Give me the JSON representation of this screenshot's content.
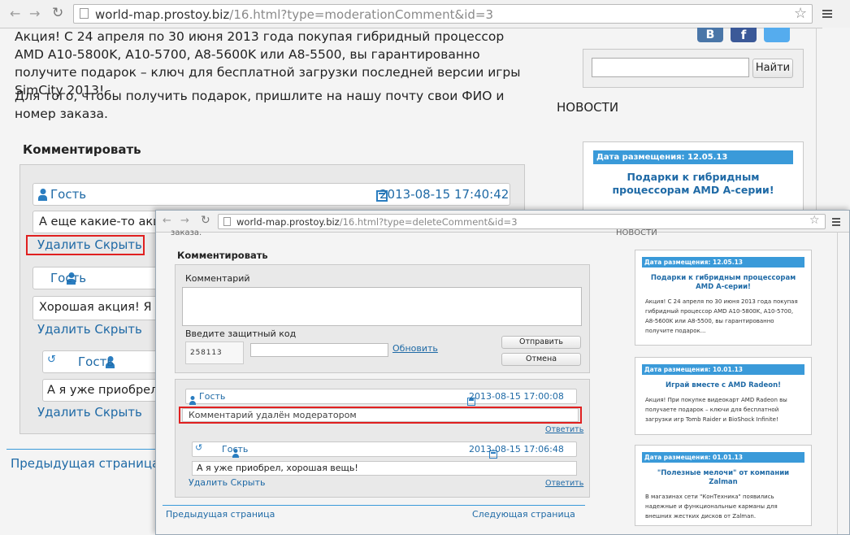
{
  "back_window": {
    "url_host": "world-map.prostoy.biz",
    "url_path": "/16.html?type=moderationComment&id=3",
    "article_p1": "Акция! С 24 апреля по 30 июня 2013 года покупая гибридный процессор AMD A10-5800K, A10-5700, A8-5600K или A8-5500, вы гарантированно получите подарок – ключ для бесплатной загрузки последней версии игры SimCity 2013!",
    "article_p2": "Для того, чтобы получить подарок, пришлите на нашу почту свои ФИО и номер заказа.",
    "comment_heading": "Комментировать",
    "comments": [
      {
        "author": "Гость",
        "date": "2013-08-15 17:40:42",
        "text": "А еще какие-то акц",
        "actions": "Удалить Скрыть"
      },
      {
        "author": "Гость",
        "text": "Хорошая акция! Я о",
        "actions": "Удалить Скрыть"
      },
      {
        "author": "Гость",
        "text": "А я уже приобрел",
        "actions": "Удалить Скрыть"
      }
    ],
    "prev_page": "Предыдущая страница",
    "social_icons": [
      "vk-icon",
      "facebook-icon",
      "twitter-icon"
    ],
    "vk_letter": "B",
    "fb_letter": "f",
    "search_button": "Найти",
    "news_heading": "НОВОСТИ",
    "news_date": "Дата размещения: 12.05.13",
    "news_title": "Подарки к гибридным процессорам AMD A-серии!"
  },
  "front_window": {
    "url_host": "world-map.prostoy.biz",
    "url_path": "/16.html?type=deleteComment&id=3",
    "cut_text_left": "заказа.",
    "cut_text_right": "НОВОСТИ",
    "comment_heading": "Комментировать",
    "form": {
      "comment_label": "Комментарий",
      "captcha_label": "Введите защитный код",
      "captcha_text": "2 5 8 1 1 3",
      "refresh_link": "Обновить",
      "submit_button": "Отправить",
      "cancel_button": "Отмена"
    },
    "comment1": {
      "author": "Гость",
      "date": "2013-08-15 17:00:08",
      "text": "Комментарий удалён модератором",
      "reply": "Ответить"
    },
    "comment2": {
      "author": "Гость",
      "date": "2013-08-15 17:06:48",
      "text": "А я уже приобрел, хорошая вещь!",
      "actions": "Удалить Скрыть",
      "reply": "Ответить"
    },
    "prev_page": "Предыдущая страница",
    "next_page": "Следующая страница",
    "news": [
      {
        "date": "Дата размещения: 12.05.13",
        "title": "Подарки к гибридным процессорам AMD A-серии!",
        "text": "Акция! С 24 апреля по 30 июня 2013 года покупая гибридный процессор AMD A10-5800K, A10-5700, A8-5600K или A8-5500, вы гарантированно получите подарок..."
      },
      {
        "date": "Дата размещения: 10.01.13",
        "title": "Играй вместе с AMD Radeon!",
        "text": "Акция! При покупке видеокарт AMD Radeon вы получаете подарок – ключи для бесплатной загрузки игр Tomb Raider и BioShock Infinite!"
      },
      {
        "date": "Дата размещения: 01.01.13",
        "title": "\"Полезные мелочи\" от компании Zalman",
        "text": "В магазинах сети \"КонТехника\" появились надежные и функциональные карманы для внешних жестких дисков от Zalman."
      }
    ]
  },
  "colors": {
    "accent": "#2a7dc0",
    "highlight_red": "#e02020",
    "news_header": "#3a9ad9"
  }
}
